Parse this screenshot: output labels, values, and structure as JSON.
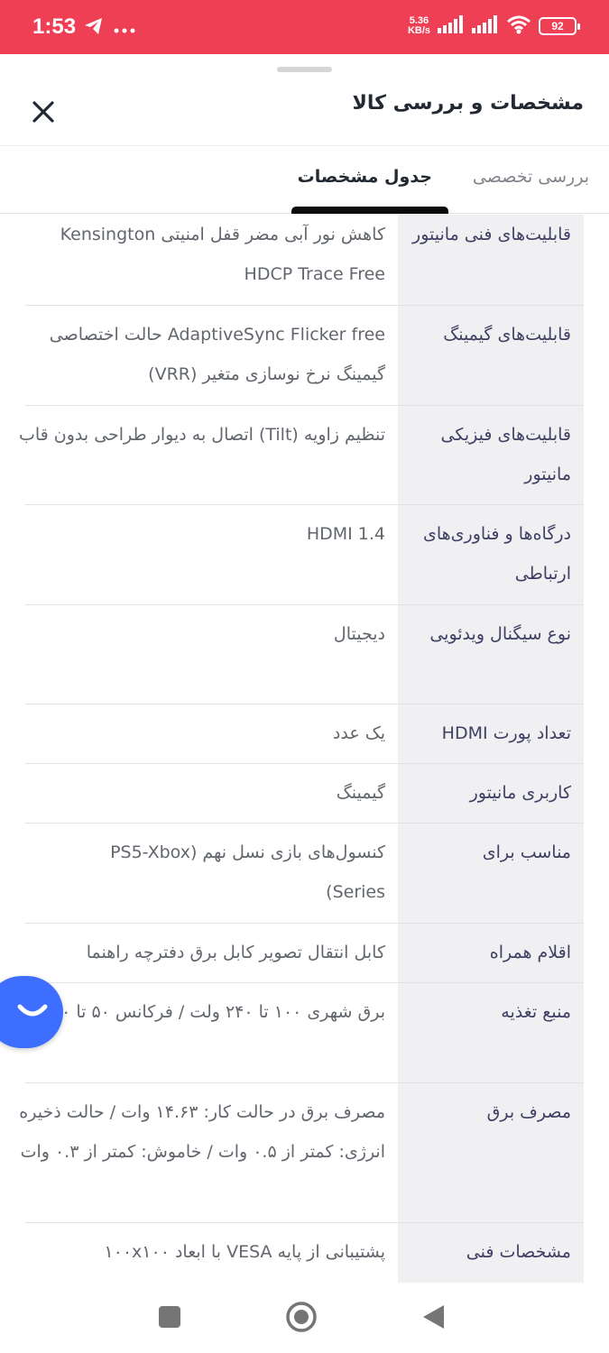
{
  "status_bar": {
    "time": "1:53",
    "net_speed_value": "5.36",
    "net_speed_unit": "KB/s",
    "battery": "92",
    "left_icons": [
      "telegram-icon",
      "more-dots-icon"
    ],
    "right_icons": [
      "signal-icon",
      "signal-icon",
      "wifi-icon",
      "battery-icon"
    ]
  },
  "sheet": {
    "title": "مشخصات و بررسی کالا",
    "close_icon": "close-icon"
  },
  "tabs": [
    {
      "label": "بررسی تخصصی",
      "active": false
    },
    {
      "label": "جدول مشخصات",
      "active": true
    }
  ],
  "specs": [
    {
      "label": "قابلیت‌های فنی مانیتور",
      "value": "کاهش نور آبی مضر قفل امنیتی Kensington HDCP Trace Free"
    },
    {
      "label": "قابلیت‌های گیمینگ",
      "value": "AdaptiveSync Flicker free حالت اختصاصی گیمینگ نرخ نوسازی متغیر (VRR)"
    },
    {
      "label": "قابلیت‌های فیزیکی مانیتور",
      "value": "تنظیم زاویه (Tilt) اتصال به دیوار طراحی بدون قاب"
    },
    {
      "label": "درگاه‌ها و فناوری‌های ارتباطی",
      "value": "HDMI 1.4"
    },
    {
      "label": "نوع سیگنال ویدئویی",
      "value": "دیجیتال"
    },
    {
      "label": "تعداد پورت HDMI",
      "value": "یک عدد"
    },
    {
      "label": "کاربری مانیتور",
      "value": "گیمینگ"
    },
    {
      "label": "مناسب برای",
      "value": "کنسول‌های بازی نسل نهم (PS5-Xbox Series)"
    },
    {
      "label": "اقلام همراه",
      "value": "کابل انتقال تصویر کابل برق دفترچه راهنما"
    },
    {
      "label": "منبع تغذیه",
      "value": "برق شهری ۱۰۰ تا ۲۴۰ ولت / فرکانس ۵۰ تا ۶۰ هرتز"
    },
    {
      "label": "مصرف برق",
      "value": "مصرف برق در حالت کار: ۱۴.۶۳ وات / حالت ذخیره انرژی: کمتر از ۰.۵ وات / خاموش: کمتر از ۰.۳ وات"
    },
    {
      "label": "مشخصات فنی",
      "value": "پشتیبانی از پایه VESA با ابعاد ۱۰۰x۱۰۰"
    }
  ],
  "fab_icon": "smile-chat-icon",
  "nav_bar": {
    "icons": [
      "recents-square-icon",
      "home-circle-icon",
      "back-triangle-icon"
    ]
  },
  "colors": {
    "status_bar": "#ef3f55",
    "fab": "#3d6eff",
    "label_bg": "#f0f0f2"
  }
}
